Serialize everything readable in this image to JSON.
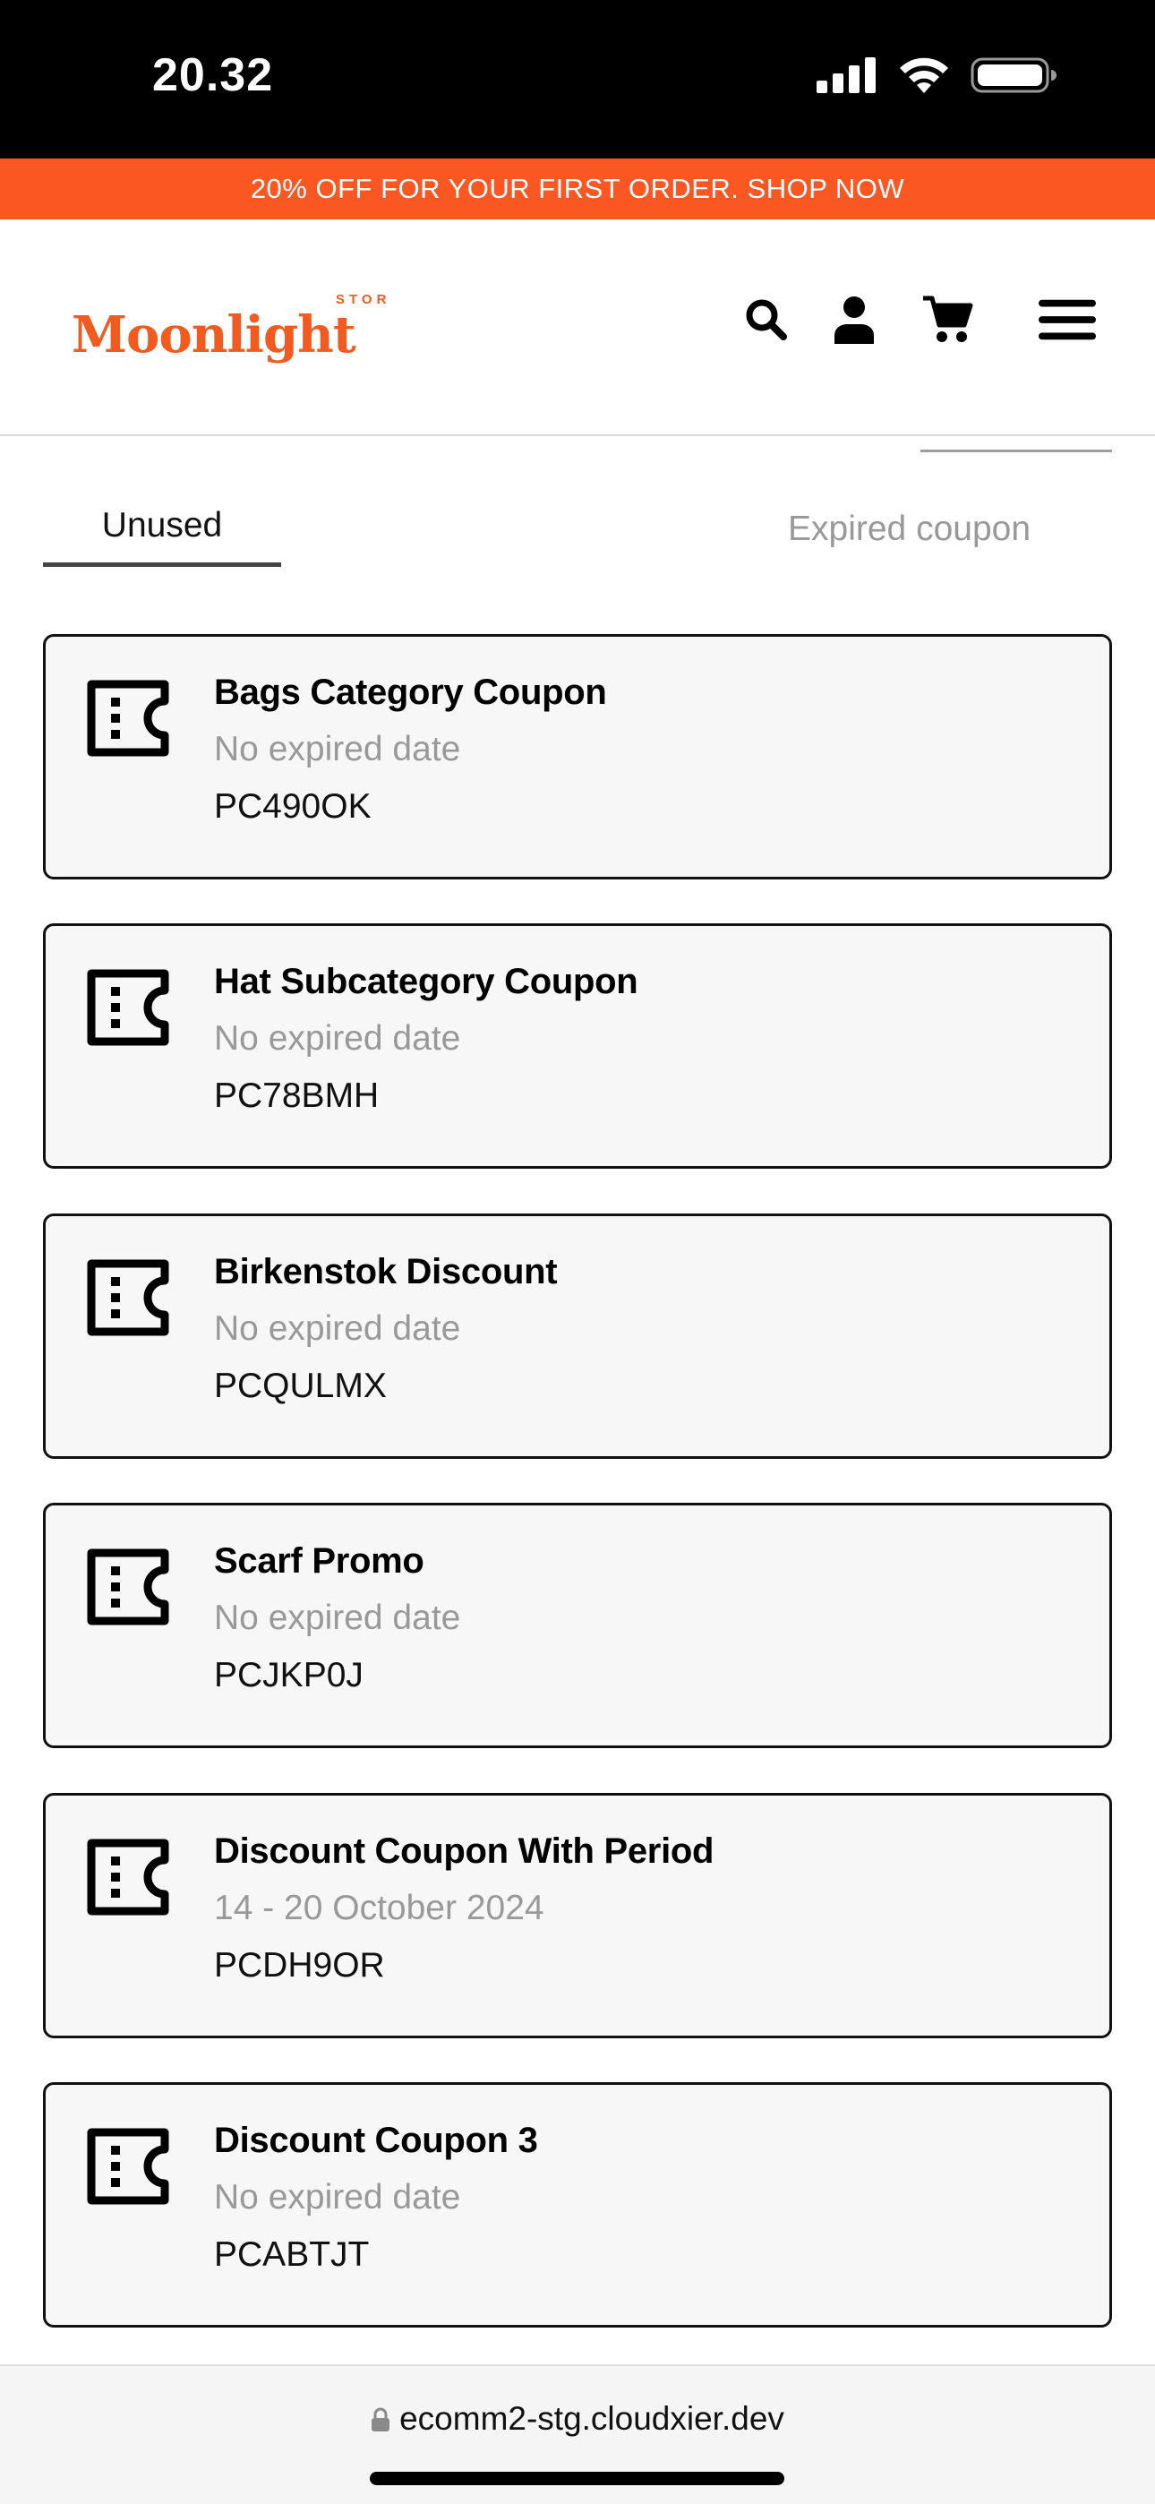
{
  "status_bar": {
    "time": "20.32"
  },
  "promo_banner": {
    "text": "20% OFF FOR YOUR FIRST ORDER. SHOP NOW",
    "background": "#fb5722"
  },
  "header": {
    "logo_text": "Moonlight",
    "logo_store_text": "STORE",
    "brand_color": "#f25b1f",
    "icons": [
      "search-icon",
      "user-icon",
      "cart-icon",
      "menu-icon"
    ]
  },
  "tabs": [
    {
      "label": "Unused",
      "active": true
    },
    {
      "label": "Expired coupon",
      "active": false
    }
  ],
  "coupons": [
    {
      "title": "Bags Category Coupon",
      "date": "No expired date",
      "code": "PC490OK"
    },
    {
      "title": "Hat Subcategory Coupon",
      "date": "No expired date",
      "code": "PC78BMH"
    },
    {
      "title": "Birkenstok Discount",
      "date": "No expired date",
      "code": "PCQULMX"
    },
    {
      "title": "Scarf Promo",
      "date": "No expired date",
      "code": "PCJKP0J"
    },
    {
      "title": "Discount Coupon With Period",
      "date": "14 - 20 October 2024",
      "code": "PCDH9OR"
    },
    {
      "title": "Discount Coupon 3",
      "date": "No expired date",
      "code": "PCABTJT"
    }
  ],
  "browser": {
    "url": "ecomm2-stg.cloudxier.dev"
  }
}
